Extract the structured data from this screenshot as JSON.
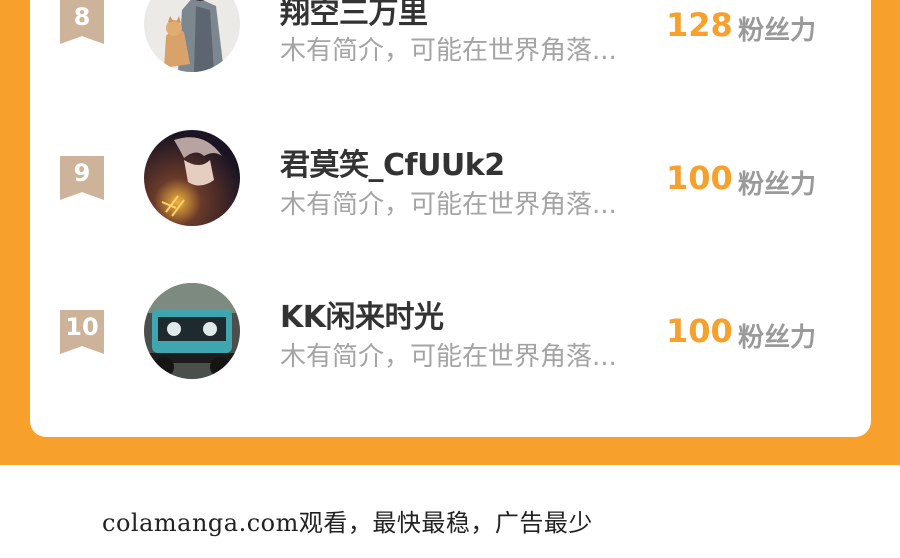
{
  "ranking": {
    "unit_label": "粉丝力",
    "rows": [
      {
        "rank": "8",
        "name": "翔空三万里",
        "bio": "木有简介，可能在世界角落...",
        "score": "128"
      },
      {
        "rank": "9",
        "name": "君莫笑_CfUUk2",
        "bio": "木有简介，可能在世界角落...",
        "score": "100"
      },
      {
        "rank": "10",
        "name": "KK闲来时光",
        "bio": "木有简介，可能在世界角落...",
        "score": "100"
      }
    ]
  },
  "footer": {
    "text": "colamanga.com观看，最快最稳，广告最少"
  },
  "colors": {
    "accent": "#f7a02b",
    "rank_badge": "#cdb399",
    "name": "#333333",
    "bio": "#a4a4a4",
    "unit": "#9a9a9a"
  }
}
